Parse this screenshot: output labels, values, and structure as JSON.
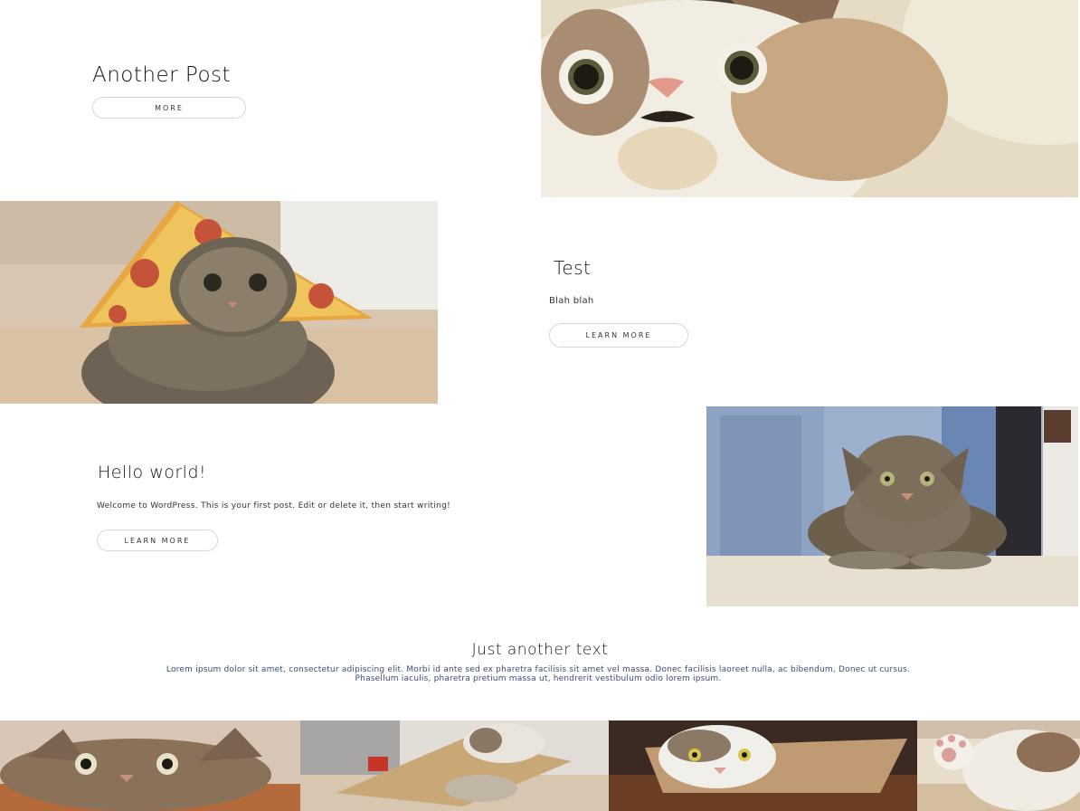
{
  "posts": [
    {
      "title": "Another Post",
      "excerpt": "",
      "button": "More",
      "image_icon": "surprised-cat-photo"
    },
    {
      "title": "Test",
      "excerpt": "Blah blah",
      "button": "Learn More",
      "image_icon": "pizza-cat-photo"
    },
    {
      "title": "Hello world!",
      "excerpt": "Welcome to WordPress. This is your first post. Edit or delete it, then start writing!",
      "button": "Learn More",
      "image_icon": "table-cat-photo"
    }
  ],
  "footer": {
    "title": "Just another text",
    "body": "Lorem ipsum dolor sit amet, consectetur adipiscing elit. Morbi id ante sed ex pharetra facilisis sit amet vel massa. Donec facilisis laoreet nulla, ac bibendum, Donec ut cursus. Phasellum iaculis, pharetra pretium massa ut, hendrerit vestibulum odio lorem ipsum."
  },
  "gallery": [
    {
      "icon": "peeking-cat-photo"
    },
    {
      "icon": "box-cat-photo"
    },
    {
      "icon": "bag-cat-photo"
    },
    {
      "icon": "paw-cat-photo"
    }
  ],
  "colors": {
    "button_border": "#d6d6d6",
    "footer_text": "#3a4a7a"
  }
}
